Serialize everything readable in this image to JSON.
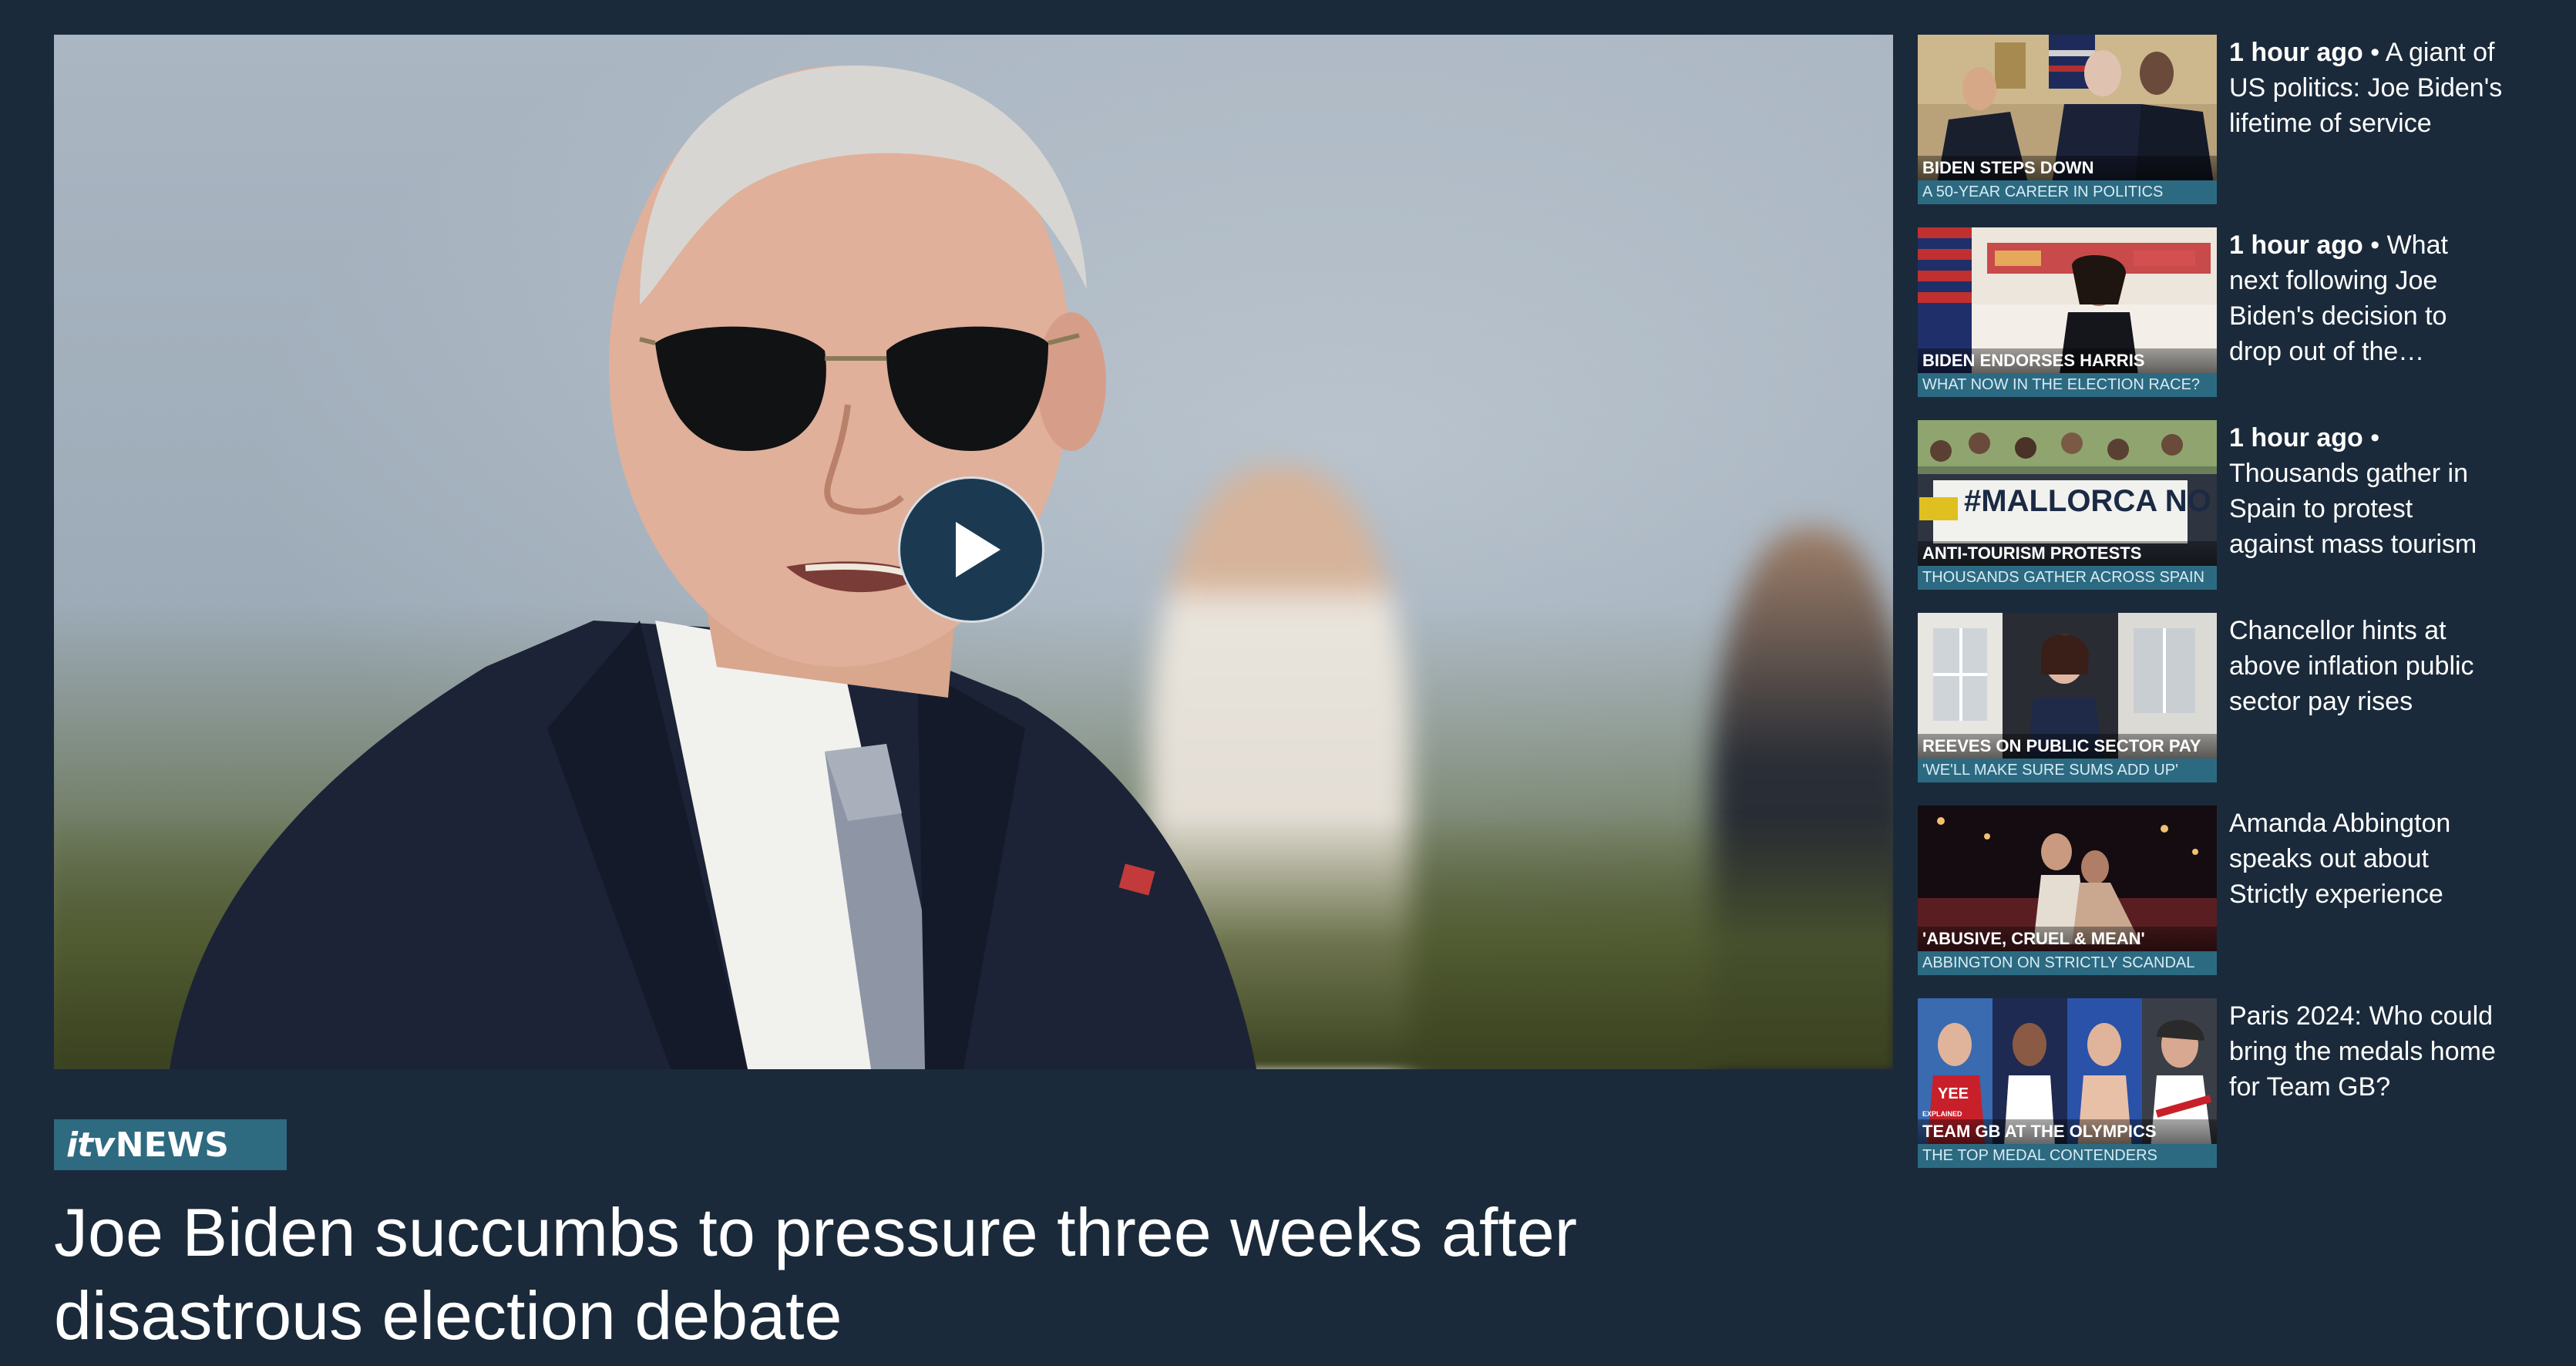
{
  "hero": {
    "headline": "Joe Biden succumbs to pressure three weeks after disastrous election debate",
    "logo_itv": "itv",
    "logo_news": "NEWS",
    "play_icon": "play-icon"
  },
  "sidebar": {
    "items": [
      {
        "time": "1 hour ago",
        "separator": " • ",
        "title": "A giant of US politics: Joe Biden's lifetime of service",
        "tag": "BIDEN STEPS DOWN",
        "subtag": "A 50-YEAR CAREER IN POLITICS"
      },
      {
        "time": "1 hour ago",
        "separator": " • ",
        "title": "What next following Joe Biden's decision to drop out of the…",
        "tag": "BIDEN ENDORSES HARRIS",
        "subtag": "WHAT NOW IN THE ELECTION RACE?"
      },
      {
        "time": "1 hour ago",
        "separator": " • ",
        "title": "Thousands gather in Spain to protest against mass tourism",
        "tag": "ANTI-TOURISM PROTESTS",
        "subtag": "THOUSANDS GATHER ACROSS SPAIN",
        "banner_text": "#MALLORCA NO VEN"
      },
      {
        "time": "",
        "separator": "",
        "title": "Chancellor hints at above inflation public sector pay rises",
        "tag": "REEVES ON PUBLIC SECTOR PAY",
        "subtag": "'WE'LL MAKE SURE SUMS ADD UP'"
      },
      {
        "time": "",
        "separator": "",
        "title": "Amanda Abbington speaks out about Strictly experience",
        "tag": "'ABUSIVE, CRUEL & MEAN'",
        "subtag": "ABBINGTON ON STRICTLY SCANDAL"
      },
      {
        "time": "",
        "separator": "",
        "title": "Paris 2024: Who could bring the medals home for Team GB?",
        "tag": "TEAM GB AT THE OLYMPICS",
        "subtag": "THE TOP MEDAL CONTENDERS",
        "shirt_text": "YEE",
        "small_label": "EXPLAINED"
      }
    ]
  },
  "colors": {
    "background": "#1a2a3a",
    "accent_teal": "#2c6a82",
    "play_button": "#1b3a52"
  }
}
